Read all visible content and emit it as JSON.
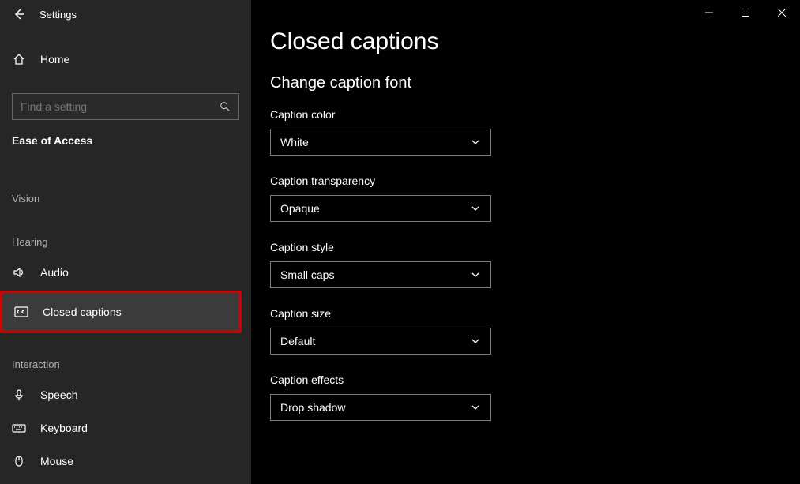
{
  "app": {
    "title": "Settings"
  },
  "sidebar": {
    "home": "Home",
    "search_placeholder": "Find a setting",
    "category": "Ease of Access",
    "groups": {
      "vision": "Vision",
      "hearing": "Hearing",
      "interaction": "Interaction"
    },
    "items": {
      "audio": "Audio",
      "closed_captions": "Closed captions",
      "speech": "Speech",
      "keyboard": "Keyboard",
      "mouse": "Mouse"
    }
  },
  "main": {
    "title": "Closed captions",
    "section": "Change caption font",
    "fields": {
      "color": {
        "label": "Caption color",
        "value": "White"
      },
      "transparency": {
        "label": "Caption transparency",
        "value": "Opaque"
      },
      "style": {
        "label": "Caption style",
        "value": "Small caps"
      },
      "size": {
        "label": "Caption size",
        "value": "Default"
      },
      "effects": {
        "label": "Caption effects",
        "value": "Drop shadow"
      }
    }
  }
}
